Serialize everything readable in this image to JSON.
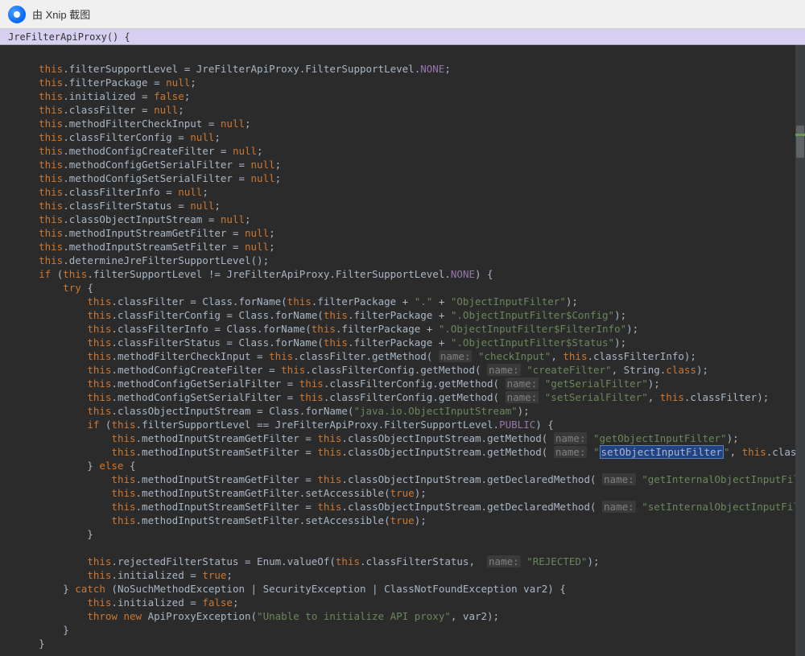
{
  "titlebar": {
    "title": "由 Xnip 截图"
  },
  "breadcrumb": "JreFilterApiProxy() {",
  "code": {
    "l1": "this.filterSupportLevel = JreFilterApiProxy.FilterSupportLevel.NONE;",
    "l2": "this.filterPackage = null;",
    "l3": "this.initialized = false;",
    "l4": "this.classFilter = null;",
    "l5": "this.methodFilterCheckInput = null;",
    "l6": "this.classFilterConfig = null;",
    "l7": "this.methodConfigCreateFilter = null;",
    "l8": "this.methodConfigGetSerialFilter = null;",
    "l9": "this.methodConfigSetSerialFilter = null;",
    "l10": "this.classFilterInfo = null;",
    "l11": "this.classFilterStatus = null;",
    "l12": "this.classObjectInputStream = null;",
    "l13": "this.methodInputStreamGetFilter = null;",
    "l14": "this.methodInputStreamSetFilter = null;",
    "l15": "this.determineJreFilterSupportLevel();",
    "l16": "if (this.filterSupportLevel != JreFilterApiProxy.FilterSupportLevel.NONE) {",
    "l17": "try {",
    "l18": "this.classFilter = Class.forName(this.filterPackage + \".\" + \"ObjectInputFilter\");",
    "l19": "this.classFilterConfig = Class.forName(this.filterPackage + \".ObjectInputFilter$Config\");",
    "l20": "this.classFilterInfo = Class.forName(this.filterPackage + \".ObjectInputFilter$FilterInfo\");",
    "l21": "this.classFilterStatus = Class.forName(this.filterPackage + \".ObjectInputFilter$Status\");",
    "l22": "this.methodFilterCheckInput = this.classFilter.getMethod( name: \"checkInput\", this.classFilterInfo);",
    "l23": "this.methodConfigCreateFilter = this.classFilterConfig.getMethod( name: \"createFilter\", String.class);",
    "l24": "this.methodConfigGetSerialFilter = this.classFilterConfig.getMethod( name: \"getSerialFilter\");",
    "l25": "this.methodConfigSetSerialFilter = this.classFilterConfig.getMethod( name: \"setSerialFilter\", this.classFilter);",
    "l26": "this.classObjectInputStream = Class.forName(\"java.io.ObjectInputStream\");",
    "l27": "if (this.filterSupportLevel == JreFilterApiProxy.FilterSupportLevel.PUBLIC) {",
    "l28": "this.methodInputStreamGetFilter = this.classObjectInputStream.getMethod( name: \"getObjectInputFilter\");",
    "l29": "this.methodInputStreamSetFilter = this.classObjectInputStream.getMethod( name: \"setObjectInputFilter\", this.classFilter)",
    "l30": "} else {",
    "l31": "this.methodInputStreamGetFilter = this.classObjectInputStream.getDeclaredMethod( name: \"getInternalObjectInputFilter\");",
    "l32": "this.methodInputStreamGetFilter.setAccessible(true);",
    "l33": "this.methodInputStreamSetFilter = this.classObjectInputStream.getDeclaredMethod( name: \"setInternalObjectInputFilter\", t",
    "l34": "this.methodInputStreamSetFilter.setAccessible(true);",
    "l35": "}",
    "l36": "",
    "l37": "this.rejectedFilterStatus = Enum.valueOf(this.classFilterStatus,  name: \"REJECTED\");",
    "l38": "this.initialized = true;",
    "l39": "} catch (NoSuchMethodException | SecurityException | ClassNotFoundException var2) {",
    "l40": "this.initialized = false;",
    "l41": "throw new ApiProxyException(\"Unable to initialize API proxy\", var2);",
    "l42": "}",
    "l43": "}"
  },
  "selection": "setObjectInputFilter"
}
